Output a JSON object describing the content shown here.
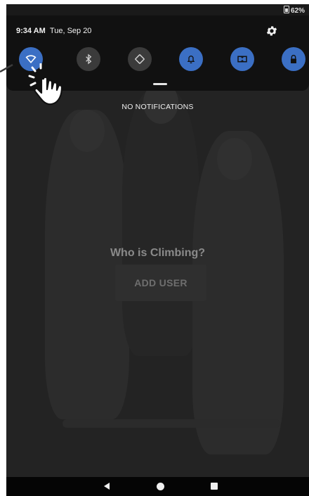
{
  "status_bar": {
    "battery": "62%"
  },
  "shade": {
    "time": "9:34 AM",
    "date": "Tue, Sep 20",
    "tiles": [
      {
        "name": "wifi-tile",
        "icon": "wifi-icon",
        "state": "on"
      },
      {
        "name": "bluetooth-tile",
        "icon": "bluetooth-icon",
        "state": "off"
      },
      {
        "name": "auto-rotate-tile",
        "icon": "rotate-icon",
        "state": "off"
      },
      {
        "name": "sound-tile",
        "icon": "bell-icon",
        "state": "on"
      },
      {
        "name": "dolby-tile",
        "icon": "dolby-icon",
        "state": "on"
      },
      {
        "name": "lock-tile",
        "icon": "lock-icon",
        "state": "on"
      }
    ],
    "accent_color": "#3b6fc4"
  },
  "notifications": {
    "empty_text": "NO NOTIFICATIONS"
  },
  "app": {
    "prompt": "Who is Climbing?",
    "add_user_label": "ADD USER"
  }
}
